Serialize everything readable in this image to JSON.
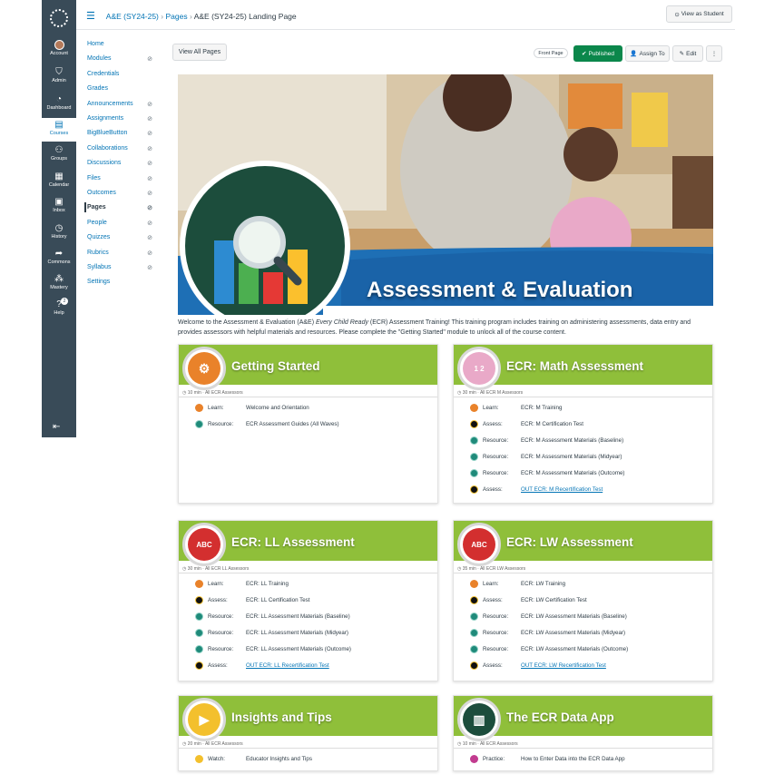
{
  "breadcrumb": {
    "course": "A&E (SY24-25)",
    "section": "Pages",
    "page": "A&E (SY24-25) Landing Page"
  },
  "header": {
    "view_as_student": "View as Student"
  },
  "global_nav": [
    {
      "label": "Account",
      "icon": "avatar"
    },
    {
      "label": "Admin",
      "icon": "shield-icon"
    },
    {
      "label": "Dashboard",
      "icon": "speedometer-icon"
    },
    {
      "label": "Courses",
      "icon": "book-icon"
    },
    {
      "label": "Groups",
      "icon": "people-icon"
    },
    {
      "label": "Calendar",
      "icon": "calendar-icon"
    },
    {
      "label": "Inbox",
      "icon": "inbox-icon"
    },
    {
      "label": "History",
      "icon": "clock-icon"
    },
    {
      "label": "Commons",
      "icon": "share-arrow-icon"
    },
    {
      "label": "Mastery",
      "icon": "network-icon"
    },
    {
      "label": "Help",
      "icon": "help-icon",
      "badge": "2"
    }
  ],
  "course_nav": [
    {
      "label": "Home",
      "hidden": false
    },
    {
      "label": "Modules",
      "hidden": true
    },
    {
      "label": "Credentials",
      "hidden": false
    },
    {
      "label": "Grades",
      "hidden": false
    },
    {
      "label": "Announcements",
      "hidden": true
    },
    {
      "label": "Assignments",
      "hidden": true
    },
    {
      "label": "BigBlueButton",
      "hidden": true
    },
    {
      "label": "Collaborations",
      "hidden": true
    },
    {
      "label": "Discussions",
      "hidden": true
    },
    {
      "label": "Files",
      "hidden": true
    },
    {
      "label": "Outcomes",
      "hidden": true
    },
    {
      "label": "Pages",
      "hidden": true,
      "active": true
    },
    {
      "label": "People",
      "hidden": true
    },
    {
      "label": "Quizzes",
      "hidden": true
    },
    {
      "label": "Rubrics",
      "hidden": true
    },
    {
      "label": "Syllabus",
      "hidden": true
    },
    {
      "label": "Settings",
      "hidden": false
    }
  ],
  "toolbar": {
    "view_all_pages": "View All Pages",
    "front_page": "Front Page",
    "published": "Published",
    "assign_to": "Assign To",
    "edit": "Edit",
    "more": "⋮"
  },
  "hero": {
    "title": "Assessment & Evaluation"
  },
  "intro": {
    "before": "Welcome to the Assessment & Evaluation (A&E) ",
    "em": "Every Child Ready",
    "after": " (ECR) Assessment Training! This training program includes training on administering assessments, data entry and provides assessors with helpful materials and resources. Please complete the \"Getting Started\" module to unlock all of the course content."
  },
  "cards": [
    {
      "title": "Getting Started",
      "meta": "10 min · All ECR Assessors",
      "rows": [
        {
          "kind": "Learn:",
          "text": "Welcome and Orientation",
          "type": "learn"
        },
        {
          "kind": "Resource:",
          "text": "ECR Assessment Guides (All Waves)",
          "type": "res"
        }
      ]
    },
    {
      "title": "ECR: Math Assessment",
      "meta": "30 min · All ECR M Assessors",
      "rows": [
        {
          "kind": "Learn:",
          "text": "ECR: M Training",
          "type": "learn"
        },
        {
          "kind": "Assess:",
          "text": "ECR: M Certification Test",
          "type": "assess"
        },
        {
          "kind": "Resource:",
          "text": "ECR: M Assessment Materials (Baseline)",
          "type": "res"
        },
        {
          "kind": "Resource:",
          "text": "ECR: M Assessment Materials (Midyear)",
          "type": "res"
        },
        {
          "kind": "Resource:",
          "text": "ECR: M Assessment Materials (Outcome)",
          "type": "res"
        },
        {
          "kind": "Assess:",
          "text": "OUT ECR: M Recertification Test",
          "type": "assess",
          "link": true
        }
      ]
    },
    {
      "title": "ECR: LL Assessment",
      "meta": "30 min · All ECR LL Assessors",
      "rows": [
        {
          "kind": "Learn:",
          "text": "ECR: LL Training",
          "type": "learn"
        },
        {
          "kind": "Assess:",
          "text": "ECR: LL Certification Test",
          "type": "assess"
        },
        {
          "kind": "Resource:",
          "text": "ECR: LL Assessment Materials (Baseline)",
          "type": "res"
        },
        {
          "kind": "Resource:",
          "text": "ECR: LL Assessment Materials (Midyear)",
          "type": "res"
        },
        {
          "kind": "Resource:",
          "text": "ECR: LL Assessment Materials (Outcome)",
          "type": "res"
        },
        {
          "kind": "Assess:",
          "text": "OUT ECR: LL Recertification Test",
          "type": "assess",
          "link": true
        }
      ]
    },
    {
      "title": "ECR: LW Assessment",
      "meta": "35 min · All ECR LW Assessors",
      "rows": [
        {
          "kind": "Learn:",
          "text": "ECR: LW Training",
          "type": "learn"
        },
        {
          "kind": "Assess:",
          "text": "ECR: LW Certification Test",
          "type": "assess"
        },
        {
          "kind": "Resource:",
          "text": "ECR: LW Assessment Materials (Baseline)",
          "type": "res"
        },
        {
          "kind": "Resource:",
          "text": "ECR: LW Assessment Materials (Midyear)",
          "type": "res"
        },
        {
          "kind": "Resource:",
          "text": "ECR: LW Assessment Materials (Outcome)",
          "type": "res"
        },
        {
          "kind": "Assess:",
          "text": "OUT ECR: LW Recertification Test",
          "type": "assess",
          "link": true
        }
      ]
    },
    {
      "title": "Insights and Tips",
      "meta": "20 min · All ECR Assessors",
      "rows": [
        {
          "kind": "Watch:",
          "text": "Educator Insights and Tips",
          "type": "watch"
        }
      ]
    },
    {
      "title": "The ECR Data App",
      "meta": "10 min · All ECR Assessors",
      "rows": [
        {
          "kind": "Practice:",
          "text": "How to Enter Data into the ECR Data App",
          "type": "prac"
        }
      ]
    }
  ]
}
